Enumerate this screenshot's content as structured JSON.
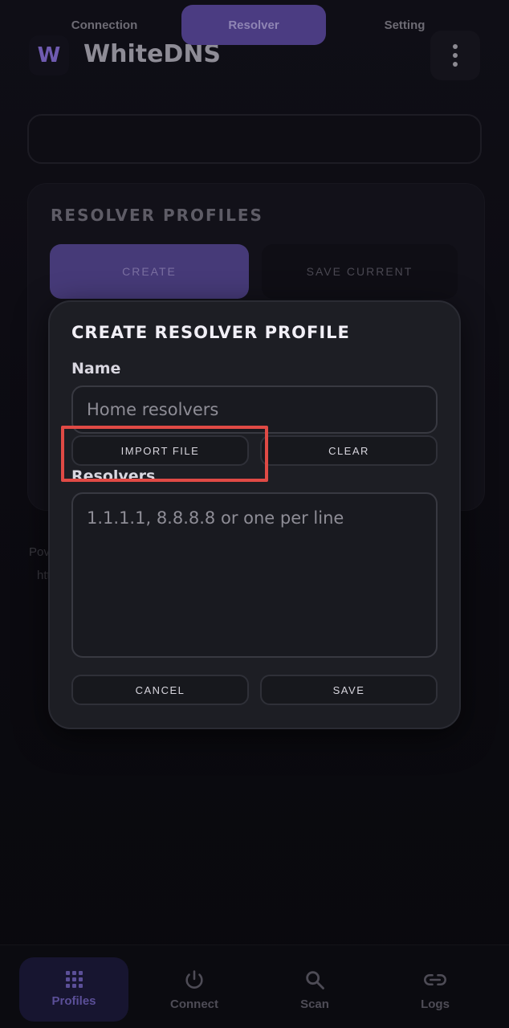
{
  "app": {
    "logo_letter": "W",
    "title": "WhiteDNS"
  },
  "tabs": [
    {
      "label": "Connection",
      "active": false
    },
    {
      "label": "Resolver",
      "active": true
    },
    {
      "label": "Setting",
      "active": false
    }
  ],
  "resolver_profiles": {
    "title": "RESOLVER PROFILES",
    "create_label": "CREATE",
    "save_current_label": "SAVE CURRENT",
    "footer_line1_partial": "Pov",
    "footer_line2_partial": "htt"
  },
  "dialog": {
    "title": "CREATE RESOLVER PROFILE",
    "name_label": "Name",
    "name_placeholder": "Home resolvers",
    "import_file_label": "IMPORT FILE",
    "clear_label": "CLEAR",
    "resolvers_label": "Resolvers",
    "resolvers_placeholder": "1.1.1.1, 8.8.8.8 or one per line",
    "cancel_label": "CANCEL",
    "save_label": "SAVE"
  },
  "bottom_nav": [
    {
      "label": "Profiles",
      "icon": "grid-icon",
      "active": true
    },
    {
      "label": "Connect",
      "icon": "power-icon",
      "active": false
    },
    {
      "label": "Scan",
      "icon": "search-icon",
      "active": false
    },
    {
      "label": "Logs",
      "icon": "link-icon",
      "active": false
    }
  ],
  "colors": {
    "accent": "#4b3c82",
    "highlight": "#e04a45",
    "dialog_bg": "#1d1e24"
  }
}
